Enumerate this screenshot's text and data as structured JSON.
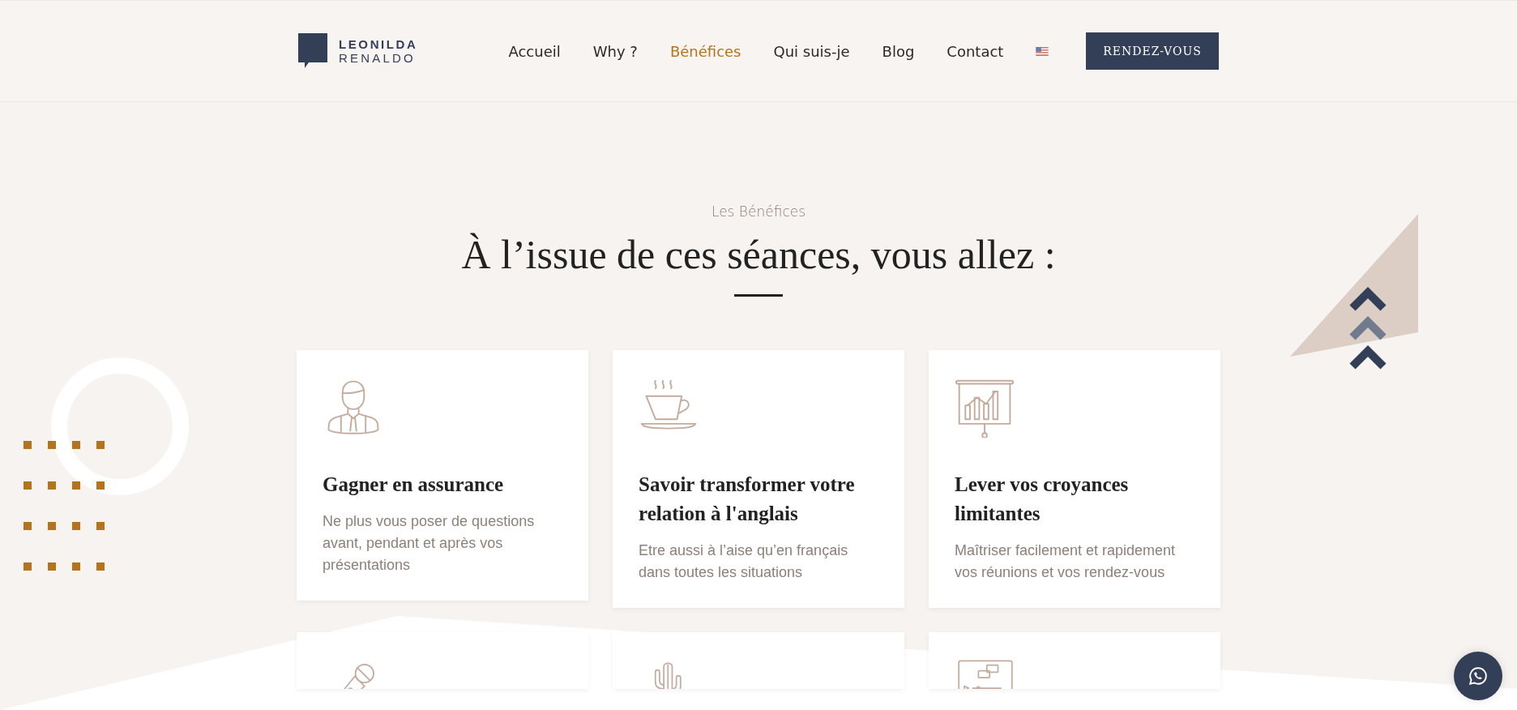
{
  "logo": {
    "line1": "LEONILDA",
    "line2": "RENALDO"
  },
  "nav": [
    {
      "label": "Accueil",
      "selected": false
    },
    {
      "label": "Why ?",
      "selected": false
    },
    {
      "label": "Bénéfices",
      "selected": true
    },
    {
      "label": "Qui suis-je",
      "selected": false
    },
    {
      "label": "Blog",
      "selected": false
    },
    {
      "label": "Contact",
      "selected": false
    }
  ],
  "cta_button": "RENDEZ-VOUS",
  "section": {
    "eyebrow": "Les Bénéfices",
    "heading": "À l’issue de ces séances, vous allez :"
  },
  "cards": [
    {
      "kind": "person",
      "title": "Gagner en assurance",
      "text": "Ne plus vous poser de questions avant, pendant et après vos présentations"
    },
    {
      "kind": "coffee",
      "title": "Savoir transformer votre relation à l'anglais",
      "text": "Etre aussi à l’aise qu’en français dans toutes les situations"
    },
    {
      "kind": "chart",
      "title": "Lever vos croyances limitantes",
      "text": "Maîtriser facilement et rapidement vos réunions et vos rendez-vous"
    },
    {
      "kind": "microphone"
    },
    {
      "kind": "cactus"
    },
    {
      "kind": "video"
    }
  ]
}
